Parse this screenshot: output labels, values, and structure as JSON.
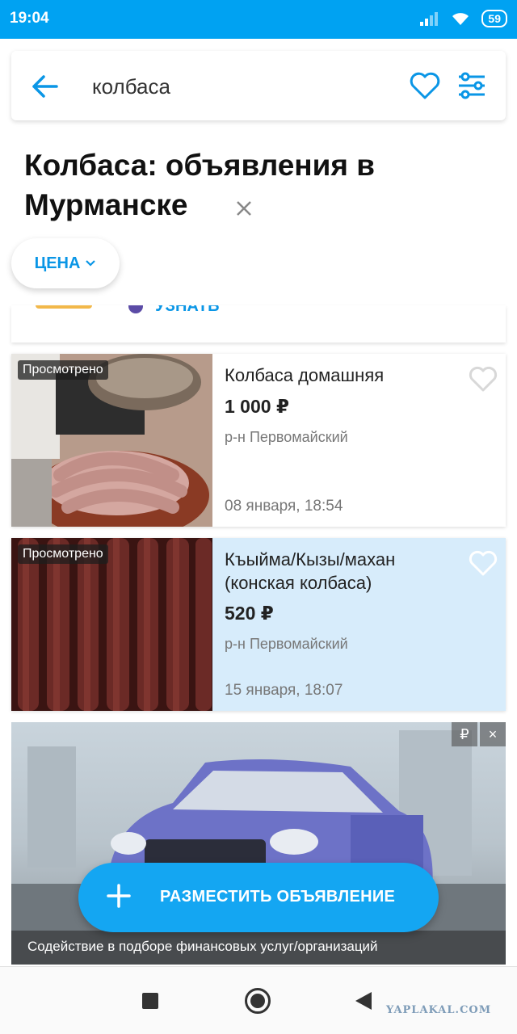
{
  "status_bar": {
    "time": "19:04",
    "battery": "59"
  },
  "search": {
    "query": "колбаса"
  },
  "page_title": "Колбаса: объявления в Мурманске",
  "filters": {
    "price_chip": "ЦЕНА"
  },
  "partial_card": {
    "text": "УЗНАТЬ"
  },
  "listings": [
    {
      "badge": "Просмотрено",
      "title": "Колбаса домашняя",
      "price": "1 000 ₽",
      "district": "р-н Первомайский",
      "date": "08 января, 18:54"
    },
    {
      "badge": "Просмотрено",
      "title": "Къыйма/Кызы/махан (конская колбаса)",
      "price": "520 ₽",
      "district": "р-н Первомайский",
      "date": "15 января, 18:07"
    }
  ],
  "ad": {
    "tag_currency": "₽",
    "tag_close": "×",
    "caption": "Содействие в подборе финансовых услуг/организаций"
  },
  "fab": {
    "label": "РАЗМЕСТИТЬ ОБЪЯВЛЕНИЕ"
  },
  "watermark": "YAPLAKAL.COM",
  "colors": {
    "accent": "#00a2f2",
    "highlight_card": "#d7ecfb",
    "link": "#0a96e6"
  }
}
